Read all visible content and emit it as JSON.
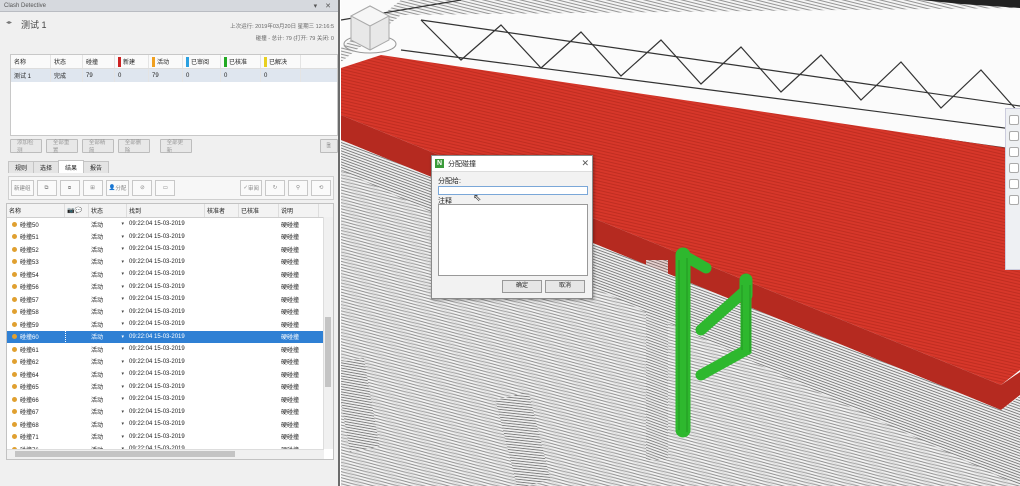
{
  "panel": {
    "title": "Clash Detective",
    "controls": "▾ ✕",
    "test_name": "测试 1",
    "last_run": "上次运行: 2019年03月20日 星期三 12:16:5",
    "counts": "碰撞 - 总计: 79  (打开: 79  关闭: 0"
  },
  "summary_table": {
    "headers": [
      "名称",
      "状态",
      "碰撞",
      "新建",
      "活动",
      "已审阅",
      "已核准",
      "已解决"
    ],
    "header_colors": [
      "",
      "",
      "",
      "#cc2222",
      "#f0a020",
      "#2aa0e0",
      "#22aa22",
      "#e8d020"
    ],
    "rows": [
      [
        "测试 1",
        "完成",
        "79",
        "0",
        "79",
        "0",
        "0",
        "0"
      ]
    ]
  },
  "test_buttons": [
    "添加检测",
    "全部重置",
    "全部精简",
    "全部删除",
    "全部更新"
  ],
  "tabs": [
    "规则",
    "选择",
    "结果",
    "报告"
  ],
  "results_toolbar": [
    "新建组",
    "分配",
    "审阅"
  ],
  "results_grid": {
    "headers": [
      "名称",
      "",
      "状态",
      "找到",
      "核准者",
      "已核准",
      "说明"
    ],
    "rows": [
      {
        "name": "碰撞50",
        "status": "活动",
        "found": "09:22:04 15-03-2019",
        "desc": "硬碰撞",
        "selected": false
      },
      {
        "name": "碰撞51",
        "status": "活动",
        "found": "09:22:04 15-03-2019",
        "desc": "硬碰撞",
        "selected": false
      },
      {
        "name": "碰撞52",
        "status": "活动",
        "found": "09:22:04 15-03-2019",
        "desc": "硬碰撞",
        "selected": false
      },
      {
        "name": "碰撞53",
        "status": "活动",
        "found": "09:22:04 15-03-2019",
        "desc": "硬碰撞",
        "selected": false
      },
      {
        "name": "碰撞54",
        "status": "活动",
        "found": "09:22:04 15-03-2019",
        "desc": "硬碰撞",
        "selected": false
      },
      {
        "name": "碰撞56",
        "status": "活动",
        "found": "09:22:04 15-03-2019",
        "desc": "硬碰撞",
        "selected": false
      },
      {
        "name": "碰撞57",
        "status": "活动",
        "found": "09:22:04 15-03-2019",
        "desc": "硬碰撞",
        "selected": false
      },
      {
        "name": "碰撞58",
        "status": "活动",
        "found": "09:22:04 15-03-2019",
        "desc": "硬碰撞",
        "selected": false
      },
      {
        "name": "碰撞59",
        "status": "活动",
        "found": "09:22:04 15-03-2019",
        "desc": "硬碰撞",
        "selected": false
      },
      {
        "name": "碰撞60",
        "status": "活动",
        "found": "09:22:04 15-03-2019",
        "desc": "硬碰撞",
        "selected": true
      },
      {
        "name": "碰撞61",
        "status": "活动",
        "found": "09:22:04 15-03-2019",
        "desc": "硬碰撞",
        "selected": false
      },
      {
        "name": "碰撞62",
        "status": "活动",
        "found": "09:22:04 15-03-2019",
        "desc": "硬碰撞",
        "selected": false
      },
      {
        "name": "碰撞64",
        "status": "活动",
        "found": "09:22:04 15-03-2019",
        "desc": "硬碰撞",
        "selected": false
      },
      {
        "name": "碰撞65",
        "status": "活动",
        "found": "09:22:04 15-03-2019",
        "desc": "硬碰撞",
        "selected": false
      },
      {
        "name": "碰撞66",
        "status": "活动",
        "found": "09:22:04 15-03-2019",
        "desc": "硬碰撞",
        "selected": false
      },
      {
        "name": "碰撞67",
        "status": "活动",
        "found": "09:22:04 15-03-2019",
        "desc": "硬碰撞",
        "selected": false
      },
      {
        "name": "碰撞68",
        "status": "活动",
        "found": "09:22:04 15-03-2019",
        "desc": "硬碰撞",
        "selected": false
      },
      {
        "name": "碰撞71",
        "status": "活动",
        "found": "09:22:04 15-03-2019",
        "desc": "硬碰撞",
        "selected": false
      },
      {
        "name": "碰撞76",
        "status": "活动",
        "found": "09:22:04 15-03-2019",
        "desc": "硬碰撞",
        "selected": false
      }
    ]
  },
  "dialog": {
    "title": "分配碰撞",
    "close": "✕",
    "assign_label": "分配给:",
    "assign_value": "",
    "notes_label": "注释",
    "notes_value": "",
    "ok_label": "确定",
    "cancel_label": "取消"
  },
  "colors": {
    "clash_red": "#d7372a",
    "clash_green": "#2eb82e",
    "selection_blue": "#2f80d4",
    "status_dot": "#e0a030"
  }
}
